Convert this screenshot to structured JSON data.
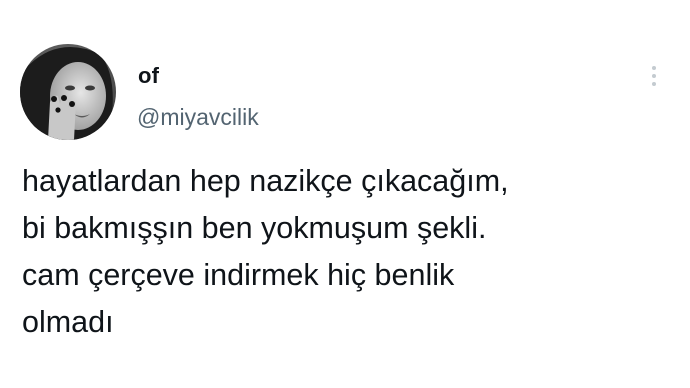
{
  "tweet": {
    "author": {
      "display_name": "of",
      "handle": "@miyavcilik",
      "avatar_icon": "profile-photo-avatar"
    },
    "more_icon": "more-vertical-icon",
    "text_lines": [
      "hayatlardan hep nazikçe çıkacağım,",
      "bi bakmışşın ben yokmuşum şekli.",
      "cam çerçeve indirmek hiç benlik",
      "olmadı"
    ]
  },
  "colors": {
    "background": "#ffffff",
    "text_primary": "#0f1419",
    "text_secondary": "#536471",
    "more_icon": "#c4cbd0"
  }
}
